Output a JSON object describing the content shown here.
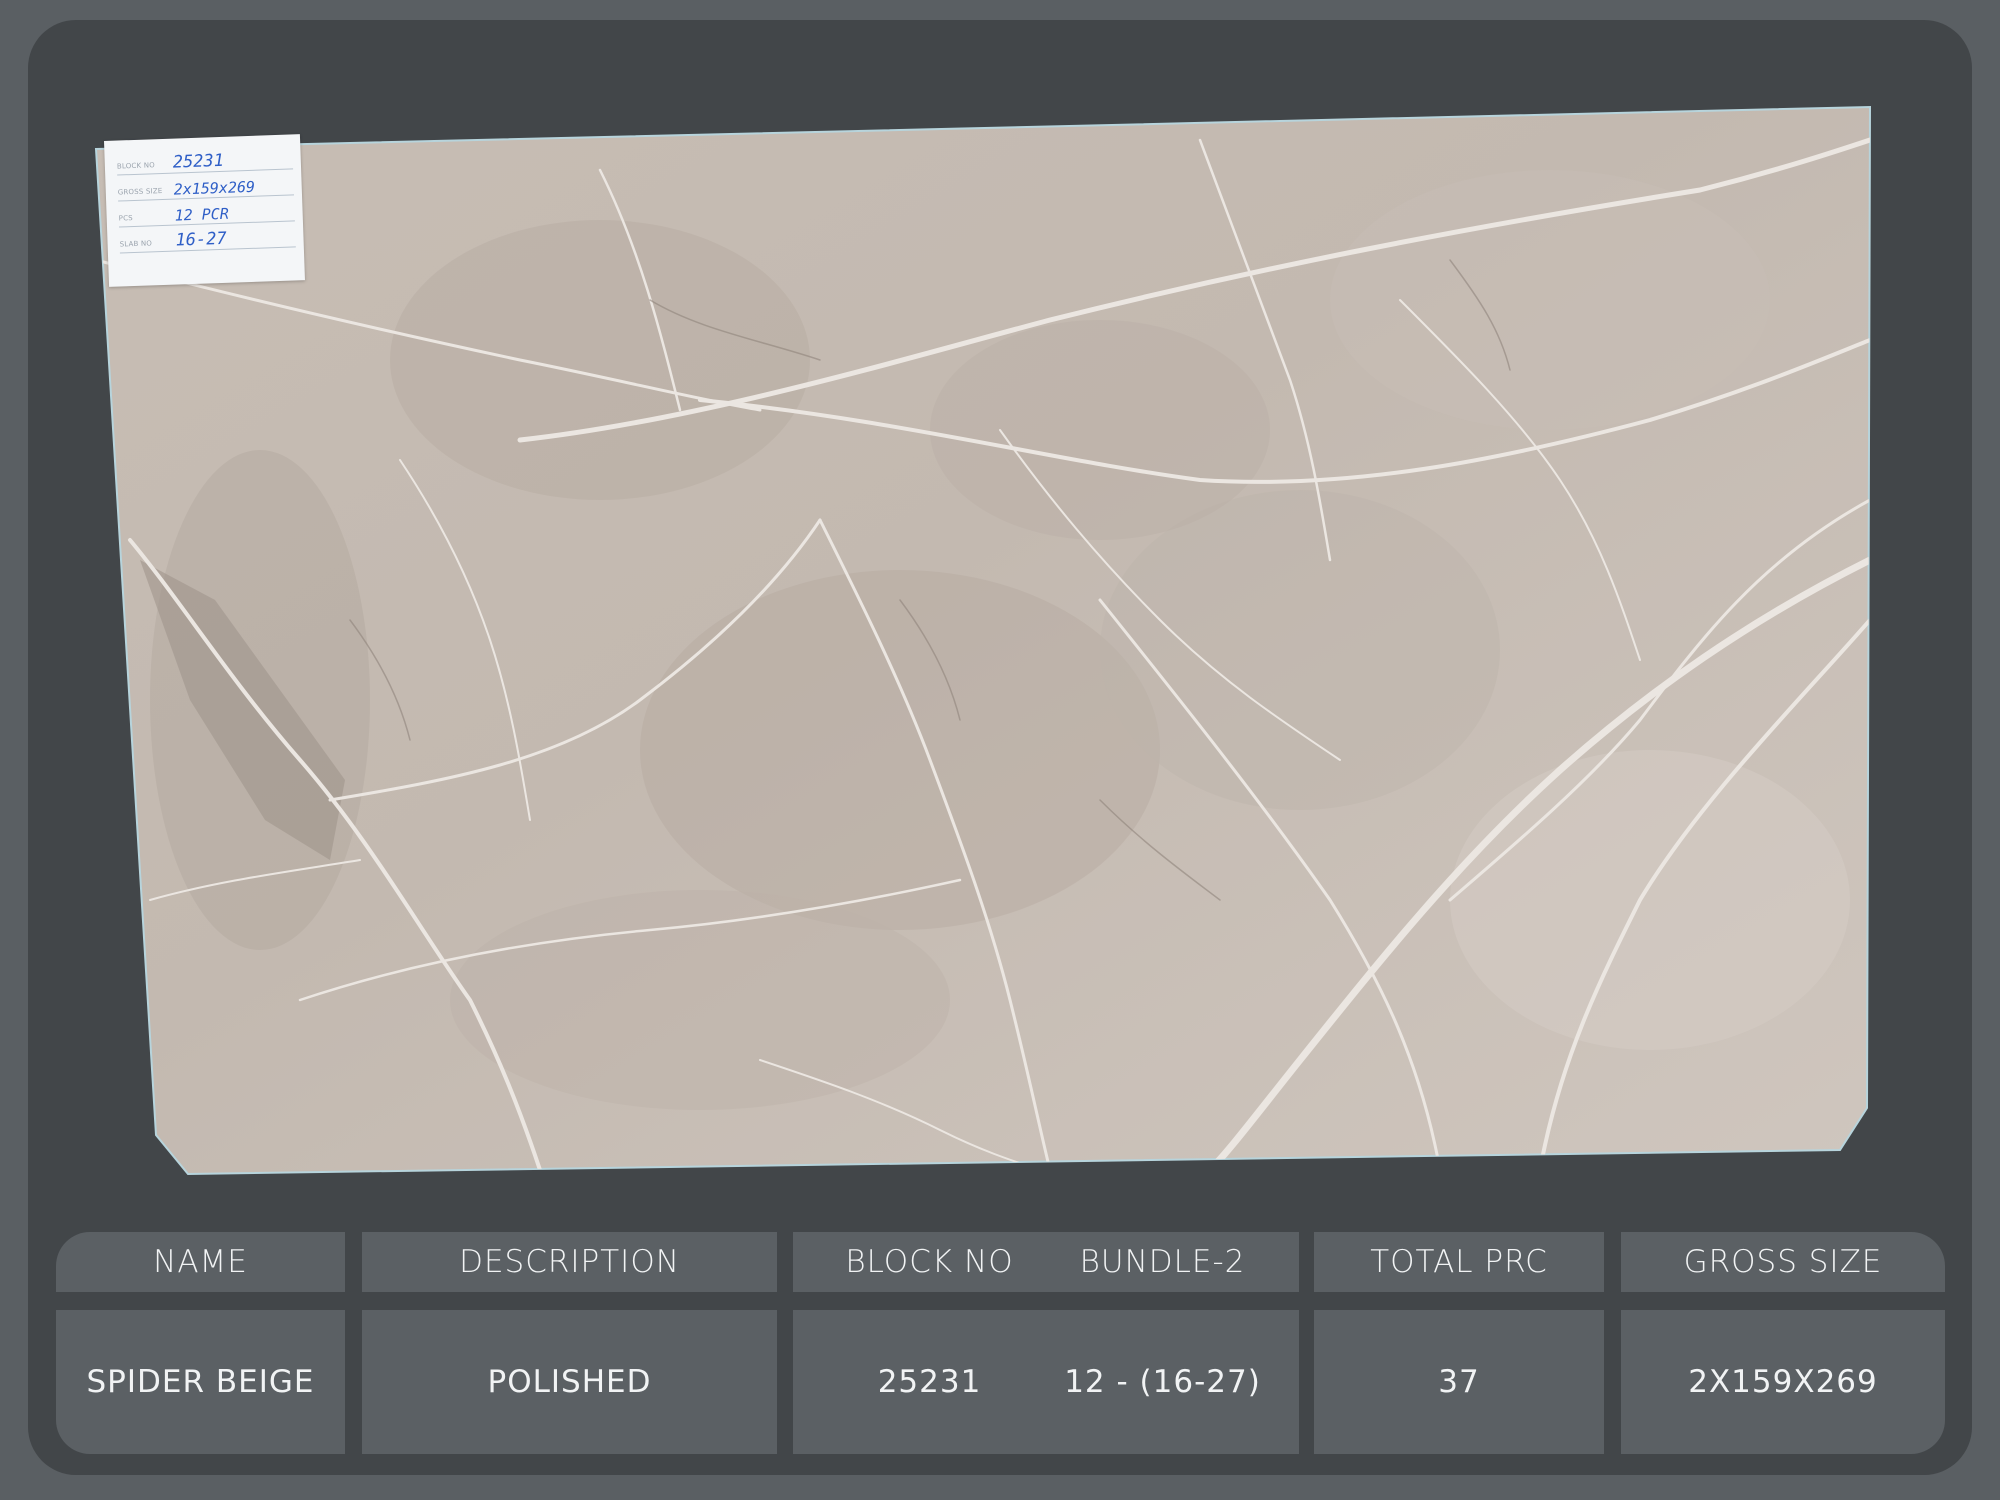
{
  "tag": {
    "rows": [
      {
        "key": "BLOCK NO",
        "value": "25231"
      },
      {
        "key": "GROSS SIZE",
        "value": "2x159x269"
      },
      {
        "key": "PCS",
        "value": "12 PCR"
      },
      {
        "key": "SLAB NO",
        "value": "16-27"
      }
    ]
  },
  "table": {
    "headers": [
      "NAME",
      "DESCRIPTION",
      "BLOCK NO",
      "BUNDLE-2",
      "TOTAL PRC",
      "GROSS SIZE"
    ],
    "values": [
      "SPIDER BEIGE",
      "POLISHED",
      "25231",
      "12 - (16-27)",
      "37",
      "2X159X269"
    ]
  },
  "colors": {
    "page_background": "#5a5f63",
    "frame": "#424649",
    "cell": "#5b6064",
    "slab": "#c9bfb6",
    "tag_ink": "#2f5fc7"
  }
}
